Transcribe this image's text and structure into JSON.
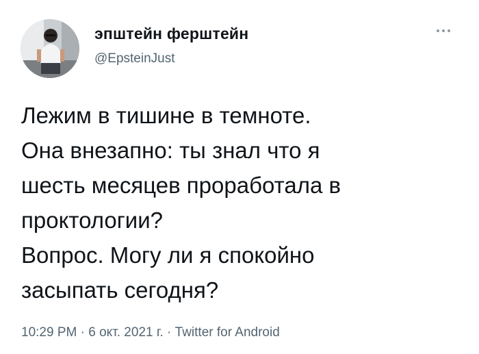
{
  "author": {
    "display_name": "эпштейн ферштейн",
    "handle": "@EpsteinJust",
    "avatar": "person-in-white-tshirt-avatar"
  },
  "menu": {
    "icon": "more-options-icon"
  },
  "tweet": {
    "lines": [
      "Лежим в тишине в темноте.",
      "Она внезапно: ты знал что я",
      "шесть месяцев проработала в",
      "проктологии?",
      "Вопрос. Могу ли я спокойно",
      "засыпать сегодня?"
    ]
  },
  "meta": {
    "time": "10:29 PM",
    "separator": " · ",
    "date": "6 окт. 2021 г.",
    "source": "Twitter for Android"
  },
  "colors": {
    "text": "#0f1419",
    "secondary": "#536471",
    "background": "#ffffff"
  }
}
